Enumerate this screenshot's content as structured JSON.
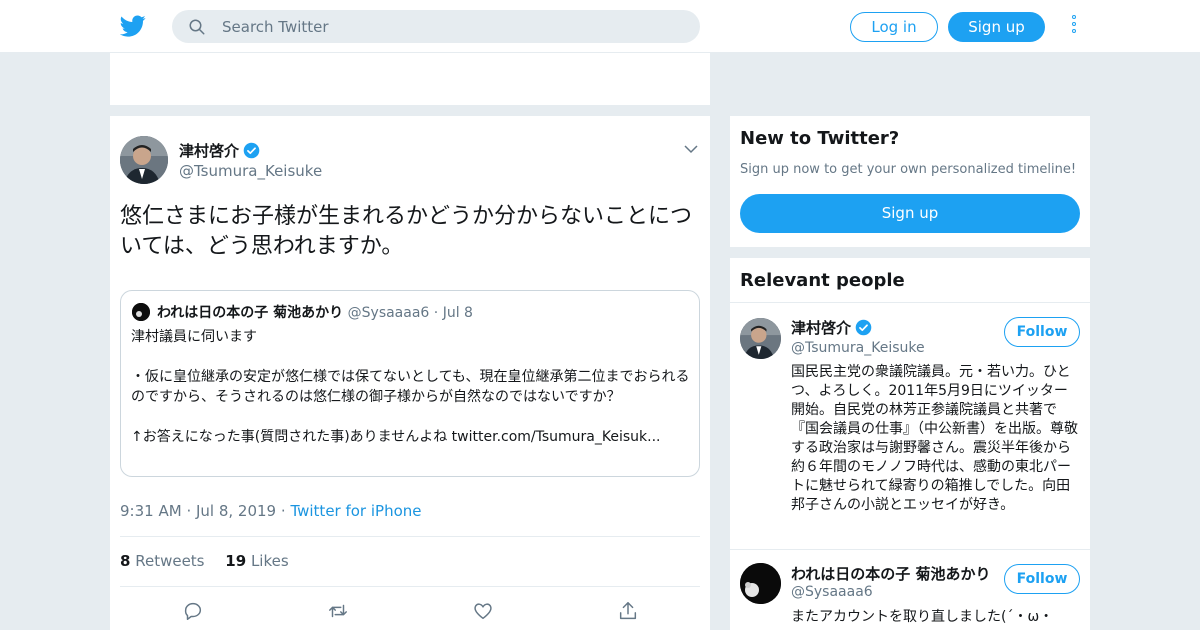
{
  "header": {
    "search_placeholder": "Search Twitter",
    "login_label": "Log in",
    "signup_label": "Sign up"
  },
  "tweet": {
    "author_name": "津村啓介",
    "author_handle": "@Tsumura_Keisuke",
    "text": "悠仁さまにお子様が生まれるかどうか分からないことについては、どう思われますか。",
    "quote": {
      "author_name": "われは日の本の子 菊池あかり",
      "author_handle": "@Sysaaaa6",
      "date": "Jul 8",
      "lines": [
        "津村議員に伺います",
        "",
        "・仮に皇位継承の安定が悠仁様では保てないとしても、現在皇位継承第二位までおられるのですから、そうされるのは悠仁様の御子様からが自然なのではないですか？",
        "",
        "↑お答えになった事(質問された事)ありませんよね twitter.com/Tsumura_Keisuk..."
      ]
    },
    "time": "9:31 AM",
    "date": "Jul 8, 2019",
    "source": "Twitter for iPhone",
    "retweets_count": "8",
    "retweets_label": "Retweets",
    "likes_count": "19",
    "likes_label": "Likes"
  },
  "sidebar": {
    "new_title": "New to Twitter?",
    "new_subtitle": "Sign up now to get your own personalized timeline!",
    "new_signup_label": "Sign up",
    "people_title": "Relevant people",
    "people": [
      {
        "name": "津村啓介",
        "handle": "@Tsumura_Keisuke",
        "follow_label": "Follow",
        "bio": "国民民主党の衆議院議員。元・若い力。ひとつ、よろしく。2011年5月9日にツイッター開始。自民党の林芳正参議院議員と共著で『国会議員の仕事』（中公新書）を出版。尊敬する政治家は与謝野馨さん。震災半年後から約６年間のモノノフ時代は、感動の東北パートに魅せられて緑寄りの箱推しでした。向田邦子さんの小説とエッセイが好き。"
      },
      {
        "name": "われは日の本の子 菊池あかり",
        "handle": "@Sysaaaa6",
        "follow_label": "Follow",
        "bio": "またアカウントを取り直しました(´・ω・"
      }
    ]
  },
  "colors": {
    "accent": "#1da1f2",
    "link": "#1b95e0",
    "background": "#e6ecf0",
    "muted": "#657786"
  },
  "icons": [
    "twitter-bird-icon",
    "search-icon",
    "more-vertical-icon",
    "verified-icon",
    "chevron-down-icon",
    "reply-icon",
    "retweet-icon",
    "like-icon",
    "share-icon"
  ]
}
